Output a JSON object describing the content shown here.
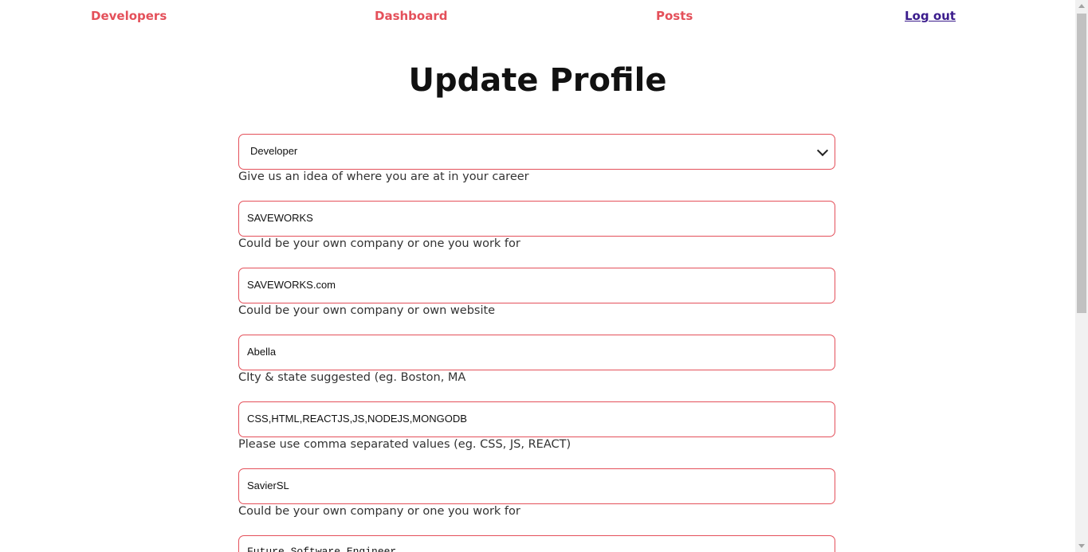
{
  "nav": {
    "developers": "Developers",
    "dashboard": "Dashboard",
    "posts": "Posts",
    "logout": "Log out"
  },
  "page": {
    "title": "Update Profile"
  },
  "form": {
    "status": {
      "value": "Developer",
      "hint": "Give us an idea of where you are at in your career"
    },
    "company": {
      "value": "SAVEWORKS",
      "hint": "Could be your own company or one you work for"
    },
    "website": {
      "value": "SAVEWORKS.com",
      "hint": "Could be your own company or own website"
    },
    "location": {
      "value": "Abella",
      "hint": "CIty & state suggested (eg. Boston, MA"
    },
    "skills": {
      "value": "CSS,HTML,REACTJS,JS,NODEJS,MONGODB",
      "hint": "Please use comma separated values (eg. CSS, JS, REACT)"
    },
    "github": {
      "value": "SavierSL",
      "hint": "Could be your own company or one you work for"
    },
    "bio": {
      "value": "Future Software Engineer"
    }
  },
  "colors": {
    "accent": "#e4505a",
    "logout": "#3b1c8c"
  }
}
